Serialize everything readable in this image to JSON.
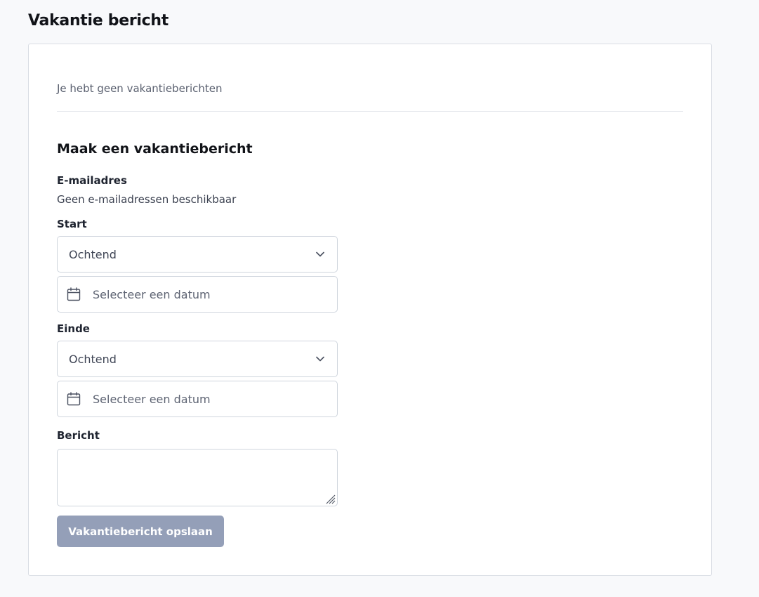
{
  "page": {
    "title": "Vakantie bericht"
  },
  "status": {
    "empty_note": "Je hebt geen vakantieberichten"
  },
  "form": {
    "title": "Maak een vakantiebericht",
    "email": {
      "label": "E-mailadres",
      "value": "Geen e-mailadressen beschikbaar"
    },
    "start": {
      "label": "Start",
      "part_of_day": "Ochtend",
      "date_placeholder": "Selecteer een datum"
    },
    "end": {
      "label": "Einde",
      "part_of_day": "Ochtend",
      "date_placeholder": "Selecteer een datum"
    },
    "message": {
      "label": "Bericht",
      "value": ""
    },
    "submit_label": "Vakantiebericht opslaan"
  },
  "icons": {
    "select": "chevron-down-icon",
    "date": "calendar-icon",
    "resize": "resize-grip-icon"
  },
  "colors": {
    "button_disabled": "#949fb8",
    "border": "#cfd5dd",
    "page_background": "#f8f9fb"
  }
}
